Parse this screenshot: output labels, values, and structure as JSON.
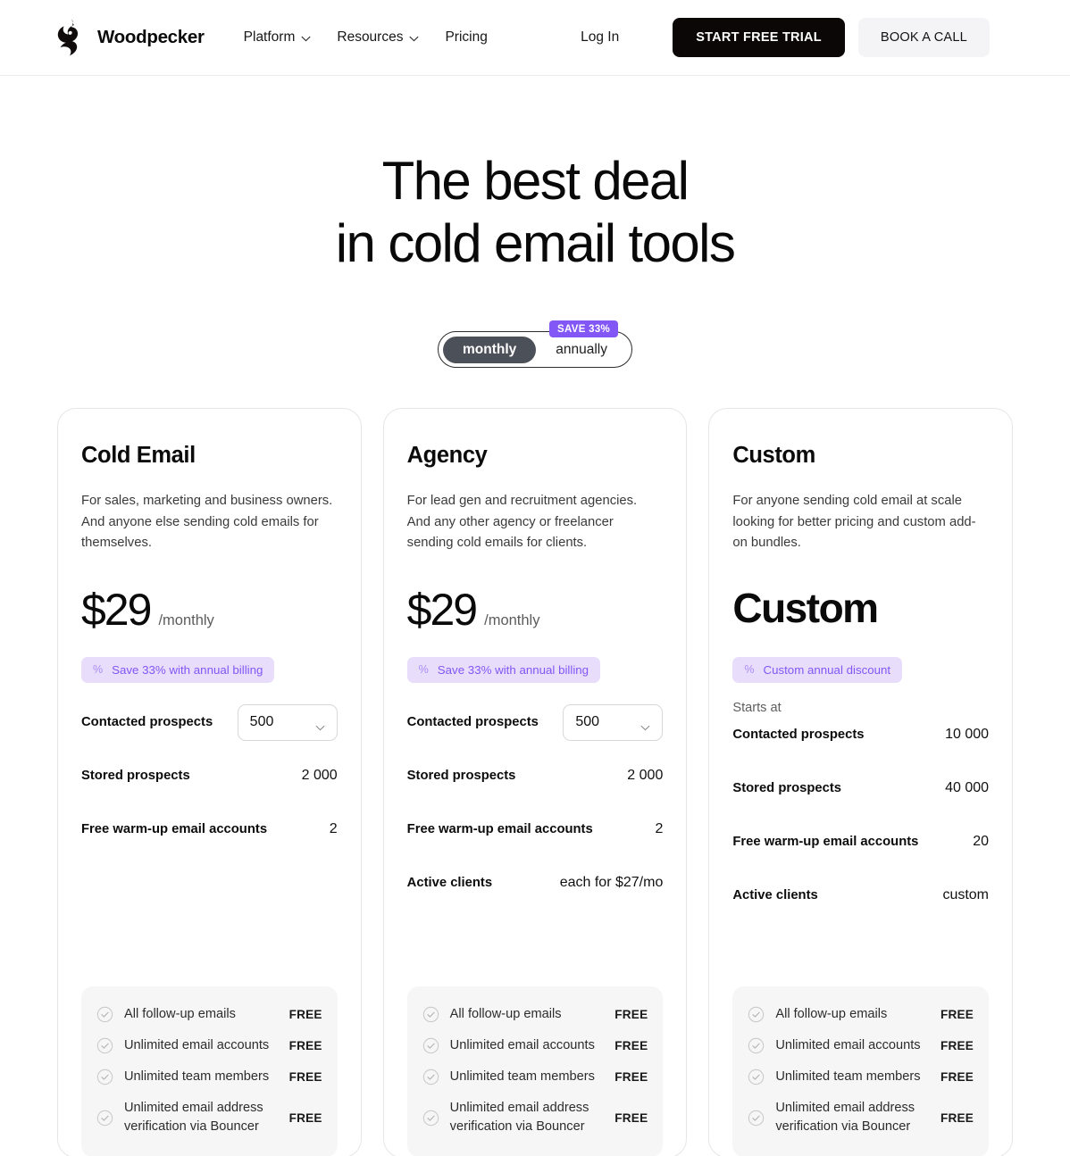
{
  "header": {
    "brand": "Woodpecker",
    "nav": [
      {
        "label": "Platform",
        "has_chevron": true
      },
      {
        "label": "Resources",
        "has_chevron": true
      },
      {
        "label": "Pricing",
        "has_chevron": false
      }
    ],
    "login": "Log In",
    "cta_primary": "START FREE TRIAL",
    "cta_secondary": "BOOK A CALL"
  },
  "hero": {
    "line1": "The best deal",
    "line2": "in cold email tools"
  },
  "billing_toggle": {
    "monthly": "monthly",
    "annually": "annually",
    "selected": "monthly",
    "save_badge": "SAVE 33%",
    "badge_color": "#8257f5"
  },
  "plans": [
    {
      "name": "Cold Email",
      "description": "For sales, marketing and business owners. And anyone else sending cold emails for themselves.",
      "price": "$29",
      "period": "/monthly",
      "discount": "Save 33% with annual billing",
      "starts_at": "",
      "specs": [
        {
          "label": "Contacted prospects",
          "value": "500",
          "type": "select"
        },
        {
          "label": "Stored prospects",
          "value": "2 000",
          "type": "text"
        },
        {
          "label": "Free warm-up email accounts",
          "value": "2",
          "type": "text"
        }
      ],
      "features": [
        {
          "name": "All follow-up emails",
          "value": "FREE"
        },
        {
          "name": "Unlimited email accounts",
          "value": "FREE"
        },
        {
          "name": "Unlimited team members",
          "value": "FREE"
        },
        {
          "name": "Unlimited email address verification via Bouncer",
          "value": "FREE"
        }
      ]
    },
    {
      "name": "Agency",
      "description": "For lead gen and recruitment agencies. And any other agency or freelancer sending cold emails for clients.",
      "price": "$29",
      "period": "/monthly",
      "discount": "Save 33% with annual billing",
      "starts_at": "",
      "specs": [
        {
          "label": "Contacted prospects",
          "value": "500",
          "type": "select"
        },
        {
          "label": "Stored prospects",
          "value": "2 000",
          "type": "text"
        },
        {
          "label": "Free warm-up email accounts",
          "value": "2",
          "type": "text"
        },
        {
          "label": "Active clients",
          "value": "each for $27/mo",
          "type": "text"
        }
      ],
      "features": [
        {
          "name": "All follow-up emails",
          "value": "FREE"
        },
        {
          "name": "Unlimited email accounts",
          "value": "FREE"
        },
        {
          "name": "Unlimited team members",
          "value": "FREE"
        },
        {
          "name": "Unlimited email address verification via Bouncer",
          "value": "FREE"
        }
      ]
    },
    {
      "name": "Custom",
      "description": "For anyone sending cold email at scale looking for better pricing and custom add-on bundles.",
      "price": "Custom",
      "period": "",
      "discount": "Custom annual discount",
      "starts_at": "Starts at",
      "specs": [
        {
          "label": "Contacted prospects",
          "value": "10 000",
          "type": "text"
        },
        {
          "label": "Stored prospects",
          "value": "40 000",
          "type": "text"
        },
        {
          "label": "Free warm-up email accounts",
          "value": "20",
          "type": "text"
        },
        {
          "label": "Active clients",
          "value": "custom",
          "type": "text"
        }
      ],
      "features": [
        {
          "name": "All follow-up emails",
          "value": "FREE"
        },
        {
          "name": "Unlimited email accounts",
          "value": "FREE"
        },
        {
          "name": "Unlimited team members",
          "value": "FREE"
        },
        {
          "name": "Unlimited email address verification via Bouncer",
          "value": "FREE"
        }
      ]
    }
  ],
  "icons": {
    "percent": "%",
    "check": "check-circle"
  }
}
